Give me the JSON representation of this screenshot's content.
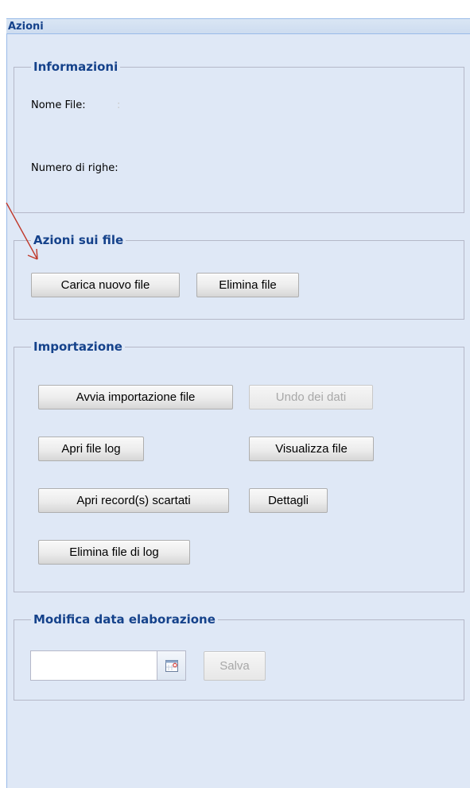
{
  "panel": {
    "title": "Azioni"
  },
  "informazioni": {
    "legend": "Informazioni",
    "nome_file_label": "Nome File:",
    "nome_file_value": ":",
    "numero_righe_label": "Numero di righe:"
  },
  "azioni_file": {
    "legend": "Azioni sui file",
    "carica_button": "Carica nuovo file",
    "elimina_button": "Elimina file"
  },
  "importazione": {
    "legend": "Importazione",
    "avvia_button": "Avvia importazione file",
    "undo_button": "Undo dei dati",
    "apri_log_button": "Apri file log",
    "visualizza_button": "Visualizza file",
    "apri_scartati_button": "Apri record(s) scartati",
    "dettagli_button": "Dettagli",
    "elimina_log_button": "Elimina file di log"
  },
  "modifica_data": {
    "legend": "Modifica data elaborazione",
    "date_value": "",
    "salva_button": "Salva"
  },
  "colors": {
    "panel_bg": "#dfe8f6",
    "title_color": "#15428b",
    "annotation_arrow": "#c0392b"
  },
  "icons": {
    "calendar_trigger": "calendar-icon",
    "annotation": "red-arrow-annotation"
  }
}
